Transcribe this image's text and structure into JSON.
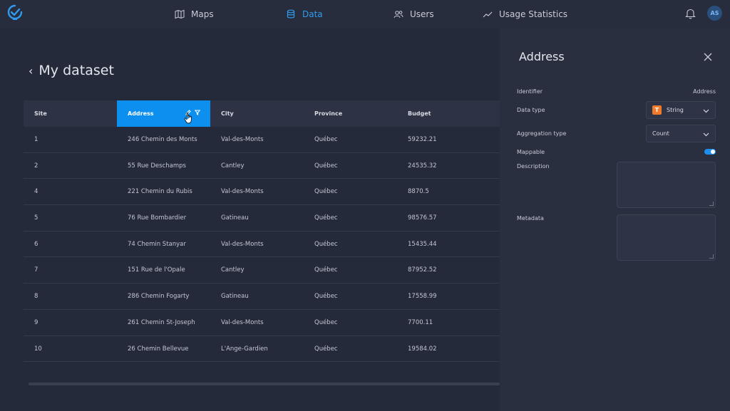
{
  "nav": {
    "items": [
      {
        "label": "Maps",
        "icon": "map-icon"
      },
      {
        "label": "Data",
        "icon": "database-icon",
        "active": true
      },
      {
        "label": "Users",
        "icon": "users-icon"
      },
      {
        "label": "Usage Statistics",
        "icon": "chart-line-icon"
      }
    ],
    "avatar_initials": "AS",
    "accent_color": "#2f9bf0"
  },
  "page": {
    "title": "My dataset"
  },
  "table": {
    "columns": [
      "Site",
      "Address",
      "City",
      "Province",
      "Budget"
    ],
    "active_column": "Address",
    "active_color": "#0d8ff0",
    "rows": [
      [
        "1",
        "246 Chemin des Monts",
        "Val-des-Monts",
        "Québec",
        "59232.21"
      ],
      [
        "2",
        "55 Rue Deschamps",
        "Cantley",
        "Québec",
        "24535.32"
      ],
      [
        "4",
        "221 Chemin du Rubis",
        "Val-des-Monts",
        "Québec",
        "8870.5"
      ],
      [
        "5",
        "76 Rue Bombardier",
        "Gatineau",
        "Québec",
        "98576.57"
      ],
      [
        "6",
        "74 Chemin Stanyar",
        "Val-des-Monts",
        "Québec",
        "15435.44"
      ],
      [
        "7",
        "151 Rue de l'Opale",
        "Cantley",
        "Québec",
        "87952.52"
      ],
      [
        "8",
        "286 Chemin Fogarty",
        "Gatineau",
        "Québec",
        "17558.99"
      ],
      [
        "9",
        "261 Chemin St-Joseph",
        "Val-des-Monts",
        "Québec",
        "7700.11"
      ],
      [
        "10",
        "26 Chemin Bellevue",
        "L'Ange-Gardien",
        "Québec",
        "19584.02"
      ]
    ]
  },
  "panel": {
    "title": "Address",
    "identifier_label": "Identifier",
    "identifier_value": "Address",
    "data_type_label": "Data type",
    "data_type_value": "String",
    "data_type_icon": "string-type-icon",
    "aggregation_label": "Aggregation type",
    "aggregation_value": "Count",
    "mappable_label": "Mappable",
    "mappable_on": true,
    "description_label": "Description",
    "description_value": "",
    "metadata_label": "Metadata",
    "metadata_value": ""
  }
}
